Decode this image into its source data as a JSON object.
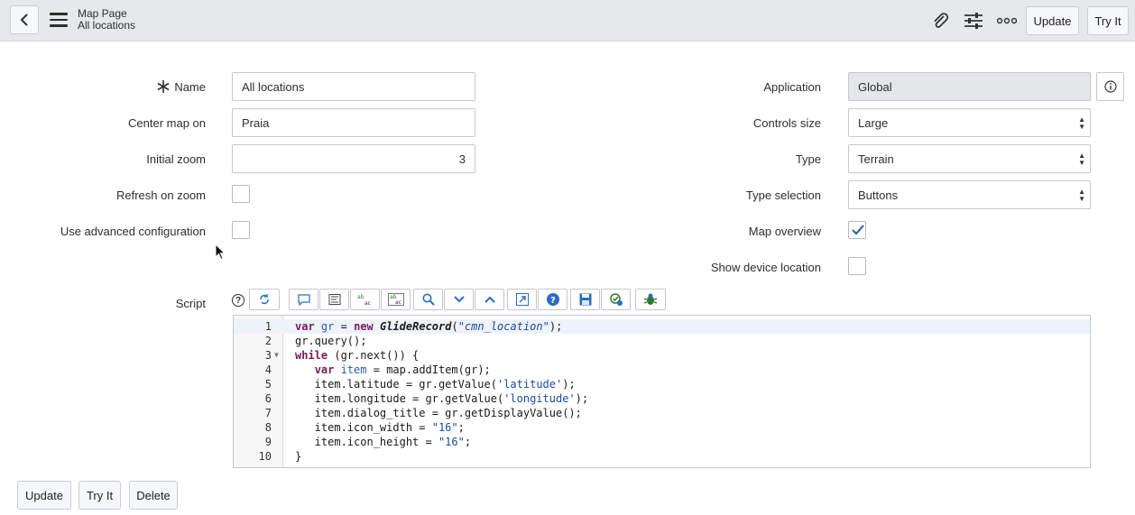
{
  "header": {
    "title": "Map Page",
    "subtitle": "All locations",
    "update_label": "Update",
    "tryit_label": "Try It",
    "icons": [
      "back-icon",
      "menu-icon",
      "paperclip-icon",
      "settings-sliders-icon",
      "more-icon"
    ]
  },
  "form": {
    "name_label": "Name",
    "name_value": "All locations",
    "center_label": "Center map on",
    "center_value": "Praia",
    "zoom_label": "Initial zoom",
    "zoom_value": "3",
    "refresh_label": "Refresh on zoom",
    "refresh_checked": false,
    "advanced_label": "Use advanced configuration",
    "advanced_checked": false,
    "application_label": "Application",
    "application_value": "Global",
    "controls_label": "Controls size",
    "controls_value": "Large",
    "type_label": "Type",
    "type_value": "Terrain",
    "type_selection_label": "Type selection",
    "type_selection_value": "Buttons",
    "overview_label": "Map overview",
    "overview_checked": true,
    "device_label": "Show device location",
    "device_checked": false,
    "script_label": "Script"
  },
  "script": {
    "line_numbers": [
      "1",
      "2",
      "3",
      "4",
      "5",
      "6",
      "7",
      "8",
      "9",
      "10"
    ],
    "lines": [
      "var gr = new GlideRecord(\"cmn_location\");",
      "gr.query();",
      "while (gr.next()) {",
      "   var item = map.addItem(gr);",
      "   item.latitude = gr.getValue('latitude');",
      "   item.longitude = gr.getValue('longitude');",
      "   item.dialog_title = gr.getDisplayValue();",
      "   item.icon_width = \"16\";",
      "   item.icon_height = \"16\";",
      "}"
    ],
    "toolbar_icons": [
      "help-icon",
      "format-icon",
      "comment-icon",
      "align-icon",
      "replace-icon",
      "replace-all-icon",
      "search-icon",
      "fold-down-icon",
      "fold-up-icon",
      "fullscreen-icon",
      "script-help-icon",
      "save-icon",
      "syntax-check-icon",
      "debug-icon"
    ]
  },
  "footer": {
    "update_label": "Update",
    "tryit_label": "Try It",
    "delete_label": "Delete"
  },
  "colors": {
    "header_bg": "#e6e8ea",
    "readonly_bg": "#e4e6e8",
    "keyword": "#7a1a5a",
    "string": "#1c4a9c"
  }
}
